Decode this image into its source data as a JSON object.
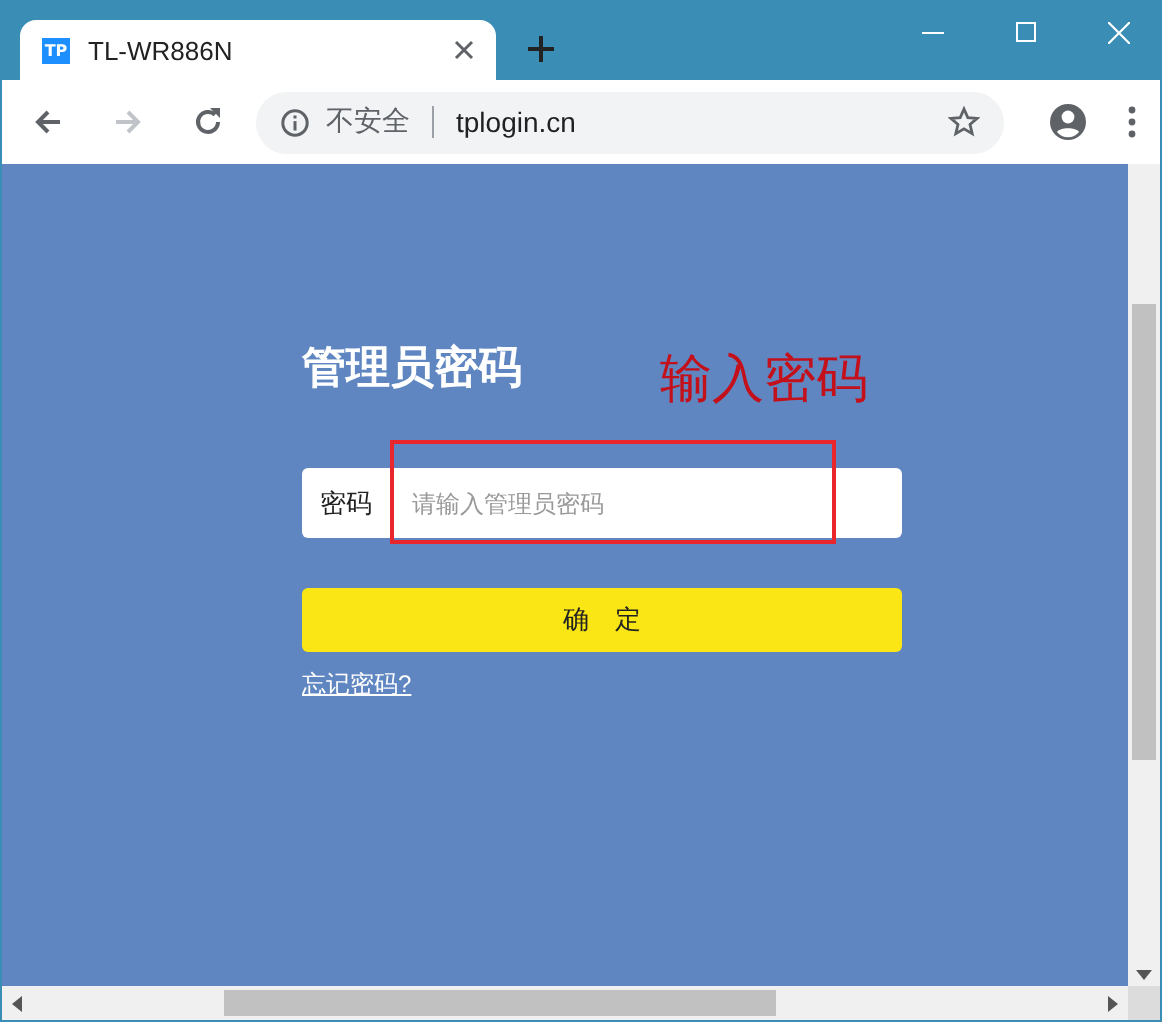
{
  "window": {
    "tab": {
      "favicon": "TP",
      "title": "TL-WR886N"
    },
    "address_bar": {
      "security": "不安全",
      "url": "tplogin.cn"
    }
  },
  "login": {
    "title": "管理员密码",
    "field": {
      "label": "密码",
      "placeholder": "请输入管理员密码"
    },
    "submit": "确　定",
    "forgot_link": "忘记密码?"
  },
  "annotation": {
    "text": "输入密码"
  }
}
